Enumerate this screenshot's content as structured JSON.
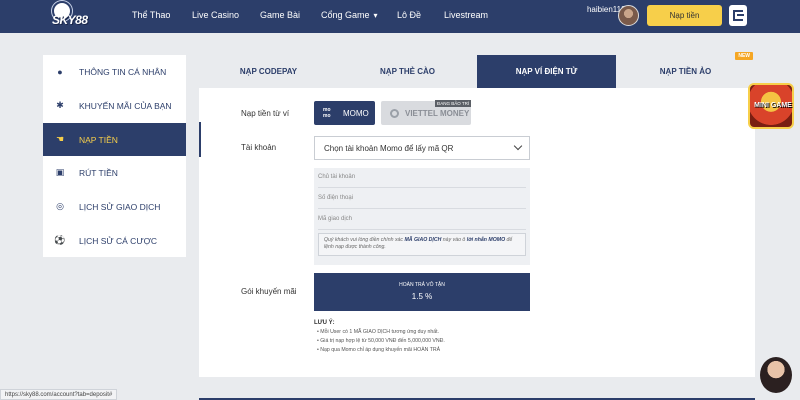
{
  "header": {
    "logo": "SKY88",
    "nav": [
      "Thể Thao",
      "Live Casino",
      "Game Bài",
      "Cổng Game",
      "Lô Đề",
      "Livestream"
    ],
    "username": "haibien1122",
    "balance": "0 Đ",
    "topup_label": "Nạp tiền"
  },
  "sidebar": {
    "items": [
      {
        "label": "THÔNG TIN CÁ NHÂN"
      },
      {
        "label": "KHUYẾN MÃI CỦA BẠN"
      },
      {
        "label": "NẠP TIỀN"
      },
      {
        "label": "RÚT TIỀN"
      },
      {
        "label": "LỊCH SỬ GIAO DỊCH"
      },
      {
        "label": "LỊCH SỬ CÁ CƯỢC"
      }
    ]
  },
  "tabs": [
    "NẠP CODEPAY",
    "NẠP THẺ CÀO",
    "NẠP VÍ ĐIỆN TỬ",
    "NẠP TIỀN ẢO"
  ],
  "new_badge": "NEW",
  "form": {
    "wallet_label": "Nạp tiền từ ví",
    "momo_mark": "mo mo",
    "momo": "MOMO",
    "viettel": "VIETTEL MONEY",
    "maintenance": "ĐANG BẢO TRÌ",
    "account_label": "Tài khoản",
    "account_select": "Chọn tài khoản Momo để lấy mã QR",
    "owner_label": "Chủ tài khoản",
    "phone_label": "Số điện thoại",
    "txn_label": "Mã giao dịch",
    "note_pre": "Quý khách vui lòng điền chính xác ",
    "note_b1": "MÃ GIAO DỊCH",
    "note_mid": " này vào ô ",
    "note_b2": "lời nhắn MOMO",
    "note_post": " để lệnh nạp được thành công.",
    "promo_label": "Gói khuyến mãi",
    "promo_title": "HOÀN TRẢ VÔ TẬN",
    "promo_value": "1.5 %"
  },
  "notes": {
    "title": "LƯU Ý:",
    "items": [
      "Mỗi User có 1 MÃ GIAO DỊCH tương ứng duy nhất.",
      "Giá trị nạp hợp lệ từ 50,000 VNĐ đến 5,000,000 VNĐ.",
      "Nạp qua Momo chỉ áp dụng khuyến mãi HOÀN TRẢ"
    ]
  },
  "status_url": "https://sky88.com/account?tab=deposit#",
  "mini_game": "MINI GAME"
}
